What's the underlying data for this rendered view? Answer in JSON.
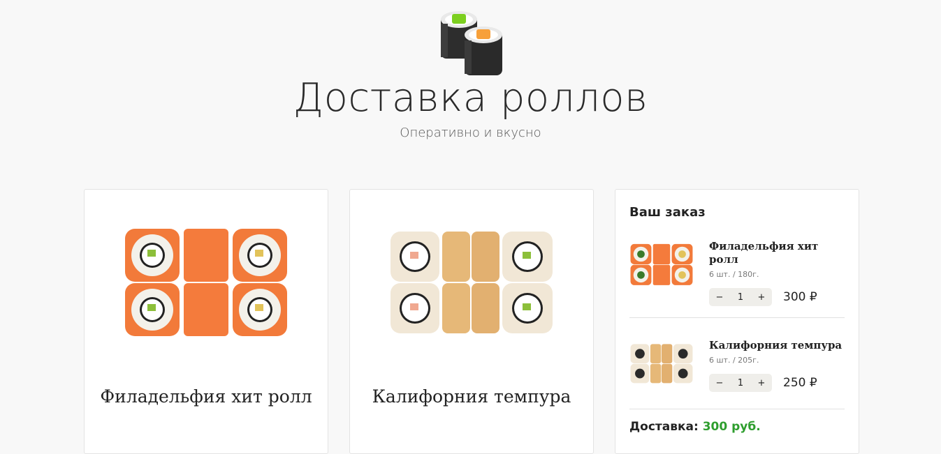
{
  "header": {
    "logo_icon": "sushi-rolls-icon",
    "title": "Доставка роллов",
    "subtitle": "Оперативно и вкусно"
  },
  "products": [
    {
      "name": "Филадельфия хит ролл",
      "image": "philadelphia-roll-image"
    },
    {
      "name": "Калифорния темпура",
      "image": "california-tempura-image"
    }
  ],
  "cart": {
    "title": "Ваш заказ",
    "items": [
      {
        "name": "Филадельфия хит ролл",
        "meta": "6 шт. / 180г.",
        "minus": "−",
        "qty": "1",
        "plus": "+",
        "price": "300 ₽"
      },
      {
        "name": "Калифорния темпура",
        "meta": "6 шт. / 205г.",
        "minus": "−",
        "qty": "1",
        "plus": "+",
        "price": "250 ₽"
      }
    ],
    "delivery_label": "Доставка:",
    "delivery_value": "300 руб."
  },
  "colors": {
    "accent_green": "#2e9e2e",
    "stepper_bg": "#efeeea",
    "background": "#f8f8f8"
  }
}
